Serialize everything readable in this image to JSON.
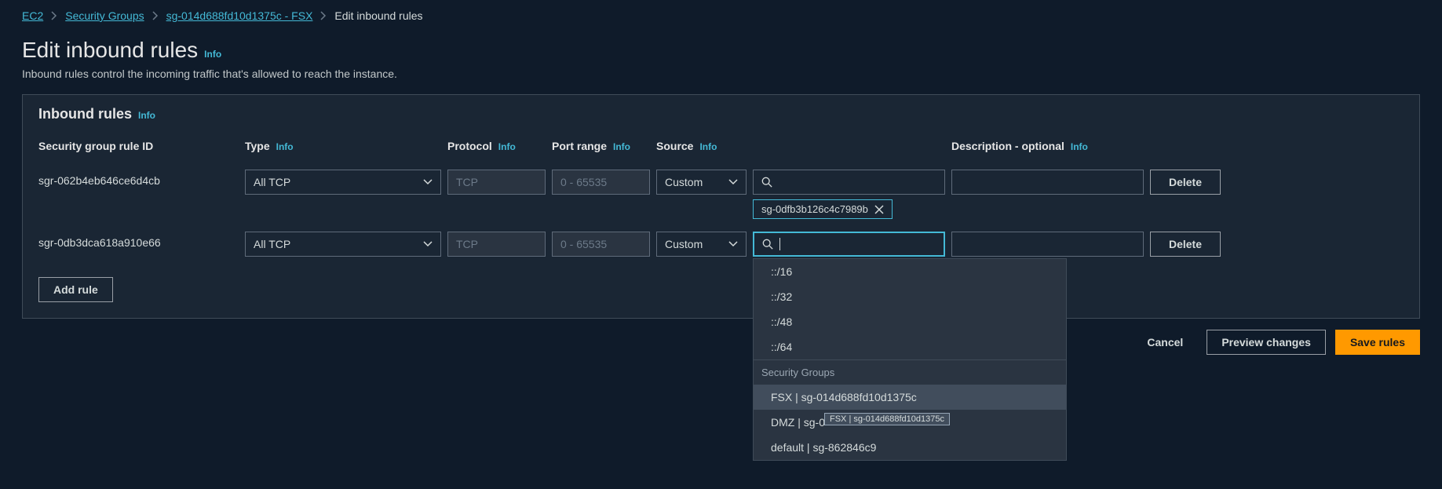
{
  "breadcrumbs": {
    "items": [
      "EC2",
      "Security Groups",
      "sg-014d688fd10d1375c - FSX"
    ],
    "current": "Edit inbound rules"
  },
  "page": {
    "title": "Edit inbound rules",
    "info": "Info",
    "subtitle": "Inbound rules control the incoming traffic that's allowed to reach the instance."
  },
  "panel": {
    "title": "Inbound rules",
    "info": "Info"
  },
  "headers": {
    "rule_id": "Security group rule ID",
    "type": "Type",
    "protocol": "Protocol",
    "port_range": "Port range",
    "source": "Source",
    "description": "Description - optional",
    "info": "Info"
  },
  "rules": [
    {
      "id": "sgr-062b4eb646ce6d4cb",
      "type": "All TCP",
      "protocol": "TCP",
      "port_range": "0 - 65535",
      "source_mode": "Custom",
      "description": "",
      "delete": "Delete",
      "tag": "sg-0dfb3b126c4c7989b"
    },
    {
      "id": "sgr-0db3dca618a910e66",
      "type": "All TCP",
      "protocol": "TCP",
      "port_range": "0 - 65535",
      "source_mode": "Custom",
      "description": "",
      "delete": "Delete"
    }
  ],
  "dropdown": {
    "cidr_options": [
      "::/16",
      "::/32",
      "::/48",
      "::/64"
    ],
    "group_label": "Security Groups",
    "sg_options": [
      "FSX | sg-014d688fd10d1375c",
      "DMZ | sg-0",
      "default | sg-862846c9"
    ],
    "tooltip": "FSX | sg-014d688fd10d1375c"
  },
  "buttons": {
    "add_rule": "Add rule",
    "cancel": "Cancel",
    "preview": "Preview changes",
    "save": "Save rules"
  }
}
